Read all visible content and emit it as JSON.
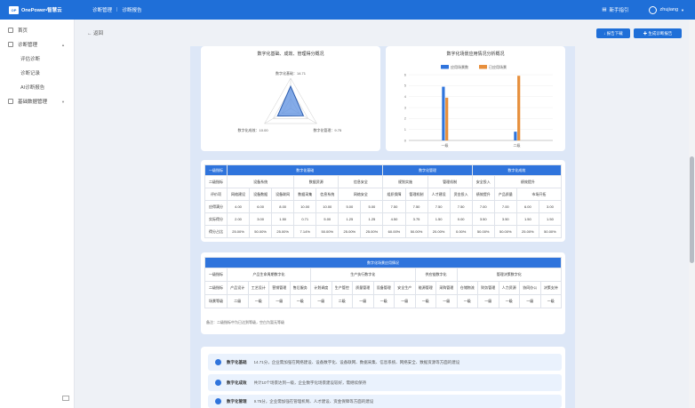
{
  "topbar": {
    "brand": "OnePower•智慧云",
    "breadcrumb": [
      "诊断管理",
      "诊断报告"
    ],
    "help": "新手指引",
    "user": "zhujiang"
  },
  "sidebar": {
    "items": [
      {
        "label": "首页"
      },
      {
        "label": "诊断管理",
        "children": [
          "评估诊断",
          "诊断记录",
          "AI诊断报告"
        ]
      },
      {
        "label": "基础数据管理"
      }
    ]
  },
  "toolbar": {
    "back": "← 返回",
    "export": "↓ 报告下载",
    "generate": "✚ 生成诊断报告"
  },
  "radar": {
    "title": "数字化基础、成效、管理得分概况",
    "labels": [
      {
        "name": "数字化基础",
        "value": "14.71"
      },
      {
        "name": "数字化成效",
        "value": "10.00"
      },
      {
        "name": "数字化管理",
        "value": "9.75"
      }
    ],
    "values": [
      14.71,
      10.0,
      9.75
    ],
    "max": 20
  },
  "chart_data": {
    "type": "bar",
    "title": "数字化场景应用情况分析概况",
    "categories": [
      "一级",
      "二级"
    ],
    "series": [
      {
        "name": "应用场景数",
        "color": "#2f74dc",
        "values": [
          4.9,
          0.8
        ]
      },
      {
        "name": "已应用场景",
        "color": "#e78f3c",
        "values": [
          3.9,
          5.9
        ]
      }
    ],
    "yticks": [
      0,
      1,
      2,
      3,
      4,
      5,
      6
    ],
    "ylim": [
      0,
      6
    ]
  },
  "table1": {
    "row1": [
      "一级指标",
      "数字化基础",
      "数字化管理",
      "数字化成效"
    ],
    "row2": [
      "二级指标",
      "设备系统",
      "数据资源",
      "信息安全",
      "规划实施",
      "管理机制",
      "安全投入",
      "绩效提升"
    ],
    "row3": [
      "评价项",
      "网络建设",
      "设备数据",
      "设备联网",
      "数据采集",
      "信息系统",
      "网络安全",
      "组织保障",
      "管理机制",
      "人才建设",
      "资金投入",
      "绩效提升",
      "产品质量",
      "市场开拓"
    ],
    "rows": [
      [
        "应得满分",
        "4.00",
        "6.00",
        "8.00",
        "10.00",
        "10.00",
        "5.00",
        "5.00",
        "7.50",
        "7.50",
        "7.50",
        "7.50",
        "7.00",
        "7.00",
        "6.00",
        "3.00"
      ],
      [
        "实际得分",
        "2.00",
        "3.00",
        "1.50",
        "0.71",
        "5.00",
        "1.25",
        "1.25",
        "4.50",
        "3.75",
        "1.50",
        "0.00",
        "3.50",
        "3.50",
        "1.50",
        "1.50"
      ],
      [
        "得分占比",
        "25.00%",
        "50.00%",
        "25.00%",
        "7.14%",
        "50.00%",
        "25.00%",
        "25.00%",
        "60.00%",
        "50.00%",
        "20.00%",
        "0.00%",
        "50.00%",
        "50.00%",
        "25.00%",
        "50.00%"
      ]
    ]
  },
  "table2": {
    "title": "数字化场景应用情况",
    "row1": [
      "一级指标",
      "产品生命周期数字化",
      "生产执行数字化",
      "供应链数字化",
      "管理决策数字化"
    ],
    "row2": [
      "二级指标",
      "产品设计",
      "工艺设计",
      "营销管理",
      "售后服务",
      "计划调度",
      "生产管控",
      "质量管理",
      "设备管理",
      "安全生产",
      "能源管理",
      "采购管理",
      "仓储物流",
      "财务管理",
      "人力资源",
      "协同办公",
      "决策支持"
    ],
    "row3": [
      "场景等级",
      "二级",
      "一级",
      "一级",
      "一级",
      "一级",
      "二级",
      "一级",
      "一级",
      "一级",
      "一级",
      "一级",
      "一级",
      "一级",
      "一级",
      "一级",
      "一级"
    ],
    "note": "备注：二级指标中为已达到等级，空白为暂无等级"
  },
  "summary": [
    {
      "label": "数字化基础",
      "text": "14.71分，企业需加强在网络建设、设备数字化、设备联网、数据采集、信息系统、网络安全、数据资源等方面的建设"
    },
    {
      "label": "数字化成效",
      "text": "共计10个场景达到一级，企业数字化场景建设较好，需继续保持"
    },
    {
      "label": "数字化管理",
      "text": "9.75分，企业需加强在管理机制、人才建设、资金保障等方面的建设"
    }
  ]
}
